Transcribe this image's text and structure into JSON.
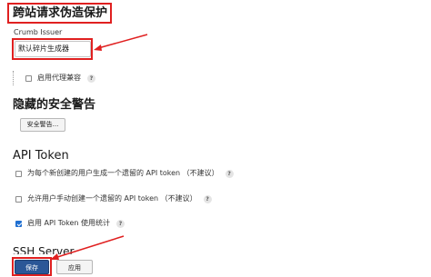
{
  "csrf": {
    "title": "跨站请求伪造保护",
    "crumb_label": "Crumb Issuer",
    "crumb_value": "默认碎片生成器",
    "proxy_compat_label": "启用代理兼容",
    "proxy_compat_help": "?"
  },
  "security_warnings": {
    "title": "隐藏的安全警告",
    "button_label": "安全警告..."
  },
  "api_token": {
    "title": "API Token",
    "options": [
      {
        "label": "为每个新创建的用户生成一个遗留的 API token （不建议）",
        "checked": false,
        "help": "?"
      },
      {
        "label": "允许用户手动创建一个遗留的 API token （不建议）",
        "checked": false,
        "help": "?"
      },
      {
        "label": "启用 API Token 使用统计",
        "checked": true,
        "help": "?"
      }
    ]
  },
  "ssh": {
    "title": "SSH Server"
  },
  "actions": {
    "save_label": "保存",
    "apply_label": "应用"
  },
  "colors": {
    "annotation_red": "#e02020",
    "primary_button": "#2b5797",
    "checkbox_checked": "#1f6fd1"
  }
}
